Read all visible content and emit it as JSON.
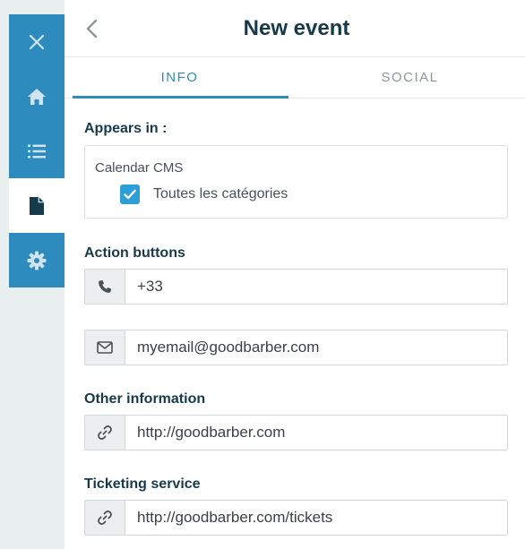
{
  "header": {
    "title": "New event"
  },
  "tabs": [
    {
      "label": "INFO",
      "active": true
    },
    {
      "label": "SOCIAL",
      "active": false
    }
  ],
  "appears_in": {
    "label": "Appears in :",
    "source": "Calendar CMS",
    "checkbox_label": "Toutes les catégories",
    "checked": true
  },
  "action_buttons": {
    "label": "Action buttons",
    "phone_value": "+33",
    "email_value": "myemail@goodbarber.com"
  },
  "other_information": {
    "label": "Other information",
    "url_value": "http://goodbarber.com"
  },
  "ticketing_service": {
    "label": "Ticketing service",
    "url_value": "http://goodbarber.com/tickets"
  },
  "colors": {
    "accent": "#2d8bbd",
    "heading": "#173a4a",
    "checkbox": "#2d9fd6"
  },
  "icons": {
    "rail": [
      "close-icon",
      "home-icon",
      "list-icon",
      "document-icon",
      "gear-icon"
    ],
    "fields": [
      "phone-icon",
      "envelope-icon",
      "link-icon",
      "link-icon"
    ]
  }
}
